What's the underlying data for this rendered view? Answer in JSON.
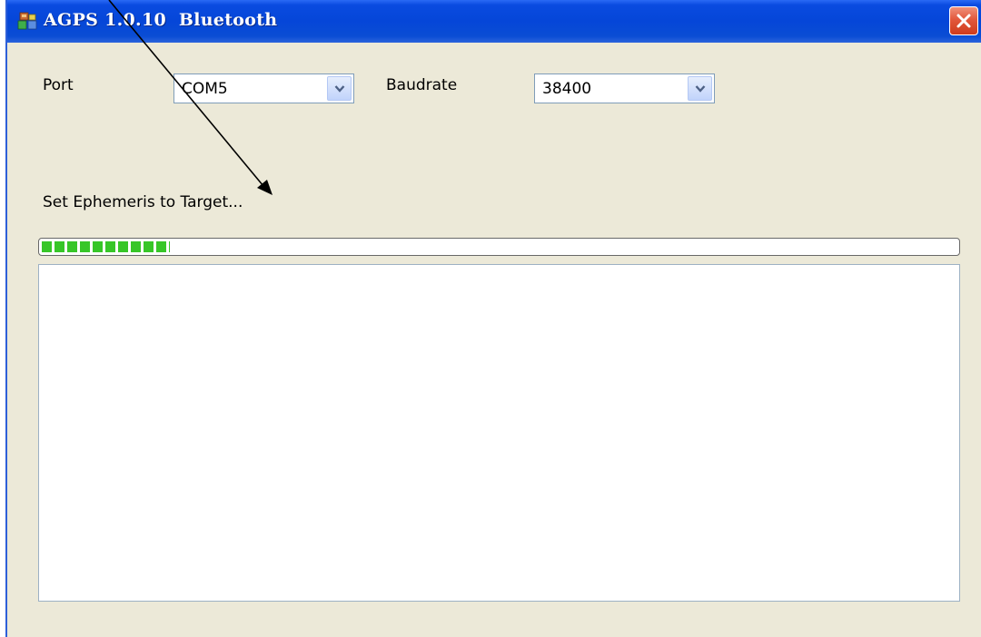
{
  "window": {
    "title": "AGPS 1.0.10  Bluetooth",
    "icon": "agps-app-icon",
    "close_icon": "close-icon"
  },
  "port": {
    "label": "Port",
    "selected": "COM5"
  },
  "baudrate": {
    "label": "Baudrate",
    "selected": "38400"
  },
  "status": {
    "text": "Set Ephemeris to Target..."
  },
  "progress": {
    "fraction": 0.14,
    "color": "#37c628"
  },
  "log": {
    "content": ""
  },
  "colors": {
    "titlebar": "#0546d8",
    "window_bg": "#ece9d8",
    "close_button": "#e2583c"
  }
}
